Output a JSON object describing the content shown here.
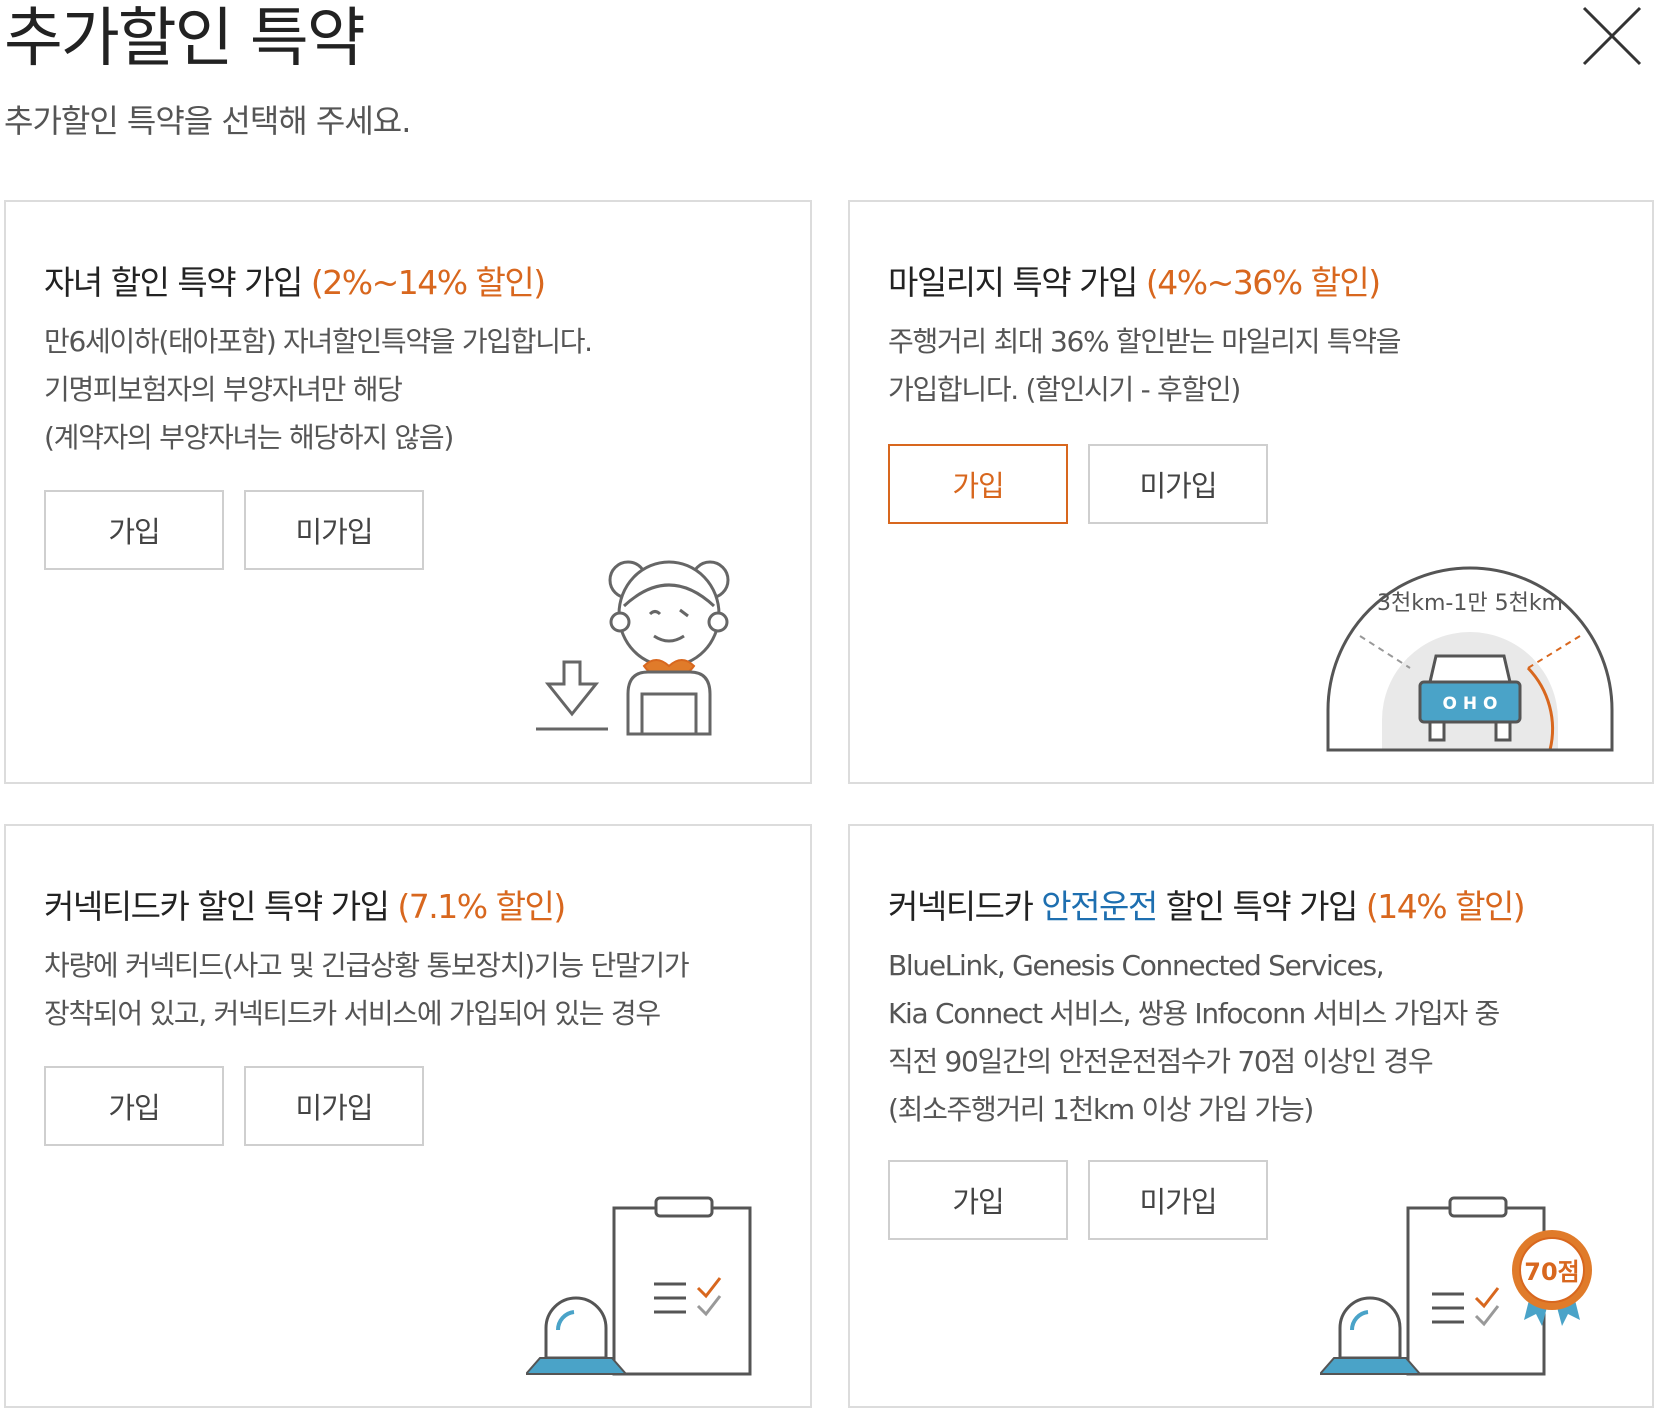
{
  "header": {
    "title": "추가할인 특약",
    "subtitle": "추가할인 특약을 선택해 주세요."
  },
  "cards": [
    {
      "title": "자녀 할인 특약 가입 ",
      "discount": "(2%~14% 할인)",
      "lines": [
        "만6세이하(태아포함) 자녀할인특약을 가입합니다.",
        "기명피보험자의 부양자녀만 해당",
        "(계약자의 부양자녀는 해당하지 않음)"
      ],
      "join_label": "가입",
      "decline_label": "미가입",
      "selected": "none"
    },
    {
      "title": "마일리지 특약 가입 ",
      "discount": "(4%~36% 할인)",
      "lines": [
        "주행거리 최대 36% 할인받는 마일리지 특약을",
        "가입합니다. (할인시기 - 후할인)"
      ],
      "join_label": "가입",
      "decline_label": "미가입",
      "selected": "join",
      "gauge_label": "3천km-1만 5천km",
      "car_plate": "O H O"
    },
    {
      "title": "커넥티드카 할인 특약 가입 ",
      "discount": "(7.1% 할인)",
      "lines": [
        "차량에 커넥티드(사고 및 긴급상황 통보장치)기능 단말기가",
        "장착되어 있고, 커넥티드카 서비스에 가입되어 있는 경우"
      ],
      "join_label": "가입",
      "decline_label": "미가입",
      "selected": "none"
    },
    {
      "title_pre": "커넥티드카 ",
      "title_highlight": "안전운전",
      "title_post": " 할인 특약 가입 ",
      "discount": "(14% 할인)",
      "lines": [
        "BlueLink, Genesis Connected Services,",
        "Kia Connect 서비스, 쌍용 Infoconn 서비스 가입자 중",
        "직전 90일간의 안전운전점수가 70점 이상인 경우",
        "(최소주행거리 1천km 이상 가입 가능)"
      ],
      "join_label": "가입",
      "decline_label": "미가입",
      "selected": "none",
      "badge": "70점"
    }
  ],
  "colors": {
    "accent": "#d8671e",
    "highlight": "#1e6fb0",
    "illustration_blue": "#4aa3c8"
  }
}
